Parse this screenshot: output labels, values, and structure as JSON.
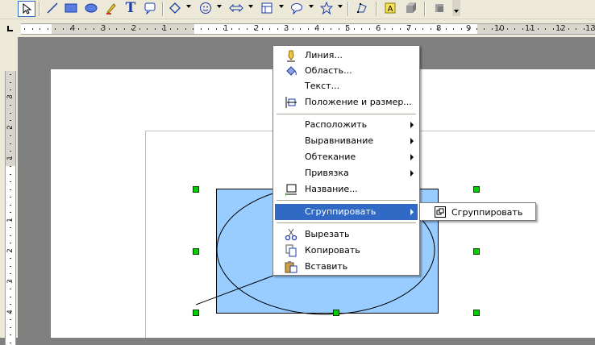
{
  "toolbar": {
    "buttons": [
      {
        "id": "select",
        "icon": "select-arrow-icon"
      },
      {
        "id": "line",
        "icon": "line-icon"
      },
      {
        "id": "rectangle",
        "icon": "rectangle-icon"
      },
      {
        "id": "ellipse",
        "icon": "ellipse-icon"
      },
      {
        "id": "freeform",
        "icon": "pencil-icon"
      },
      {
        "id": "text",
        "icon": "text-icon",
        "glyph": "T"
      },
      {
        "id": "callouts",
        "icon": "callout-icon"
      },
      {
        "id": "basic-shapes",
        "icon": "diamond-icon"
      },
      {
        "id": "symbol-shapes",
        "icon": "smiley-icon"
      },
      {
        "id": "block-arrows",
        "icon": "double-arrow-icon"
      },
      {
        "id": "flowchart",
        "icon": "flowchart-icon"
      },
      {
        "id": "callout-shapes",
        "icon": "speech-bubble-icon"
      },
      {
        "id": "stars",
        "icon": "star-icon"
      },
      {
        "id": "points",
        "icon": "points-icon"
      },
      {
        "id": "fontwork",
        "icon": "fontwork-icon"
      },
      {
        "id": "extrusion",
        "icon": "extrusion-icon"
      },
      {
        "id": "more",
        "icon": "chevron-down-icon"
      }
    ]
  },
  "rulers": {
    "horizontal_labels": [
      "4",
      "3",
      "2",
      "1",
      "1",
      "2",
      "3",
      "4",
      "5",
      "6",
      "7",
      "8",
      "9",
      "10",
      "11",
      "12",
      "13"
    ],
    "vertical_labels": [
      "3",
      "2",
      "1",
      "1",
      "2",
      "3",
      "4"
    ]
  },
  "context_menu": {
    "items": [
      {
        "label": "Линия...",
        "icon": "line-pen-icon",
        "submenu": false
      },
      {
        "label": "Область...",
        "icon": "paint-bucket-icon",
        "submenu": false
      },
      {
        "label": "Текст...",
        "icon": "",
        "submenu": false
      },
      {
        "label": "Положение и размер...",
        "icon": "position-size-icon",
        "submenu": false
      },
      {
        "label": "Расположить",
        "icon": "",
        "submenu": true
      },
      {
        "label": "Выравнивание",
        "icon": "",
        "submenu": true
      },
      {
        "label": "Обтекание",
        "icon": "",
        "submenu": true
      },
      {
        "label": "Привязка",
        "icon": "",
        "submenu": true
      },
      {
        "label": "Название...",
        "icon": "caption-icon",
        "submenu": false
      },
      {
        "label": "Сгруппировать",
        "icon": "",
        "submenu": true,
        "highlighted": true
      },
      {
        "label": "Вырезать",
        "icon": "scissors-icon",
        "submenu": false
      },
      {
        "label": "Копировать",
        "icon": "copy-icon",
        "submenu": false
      },
      {
        "label": "Вставить",
        "icon": "paste-icon",
        "submenu": false
      }
    ]
  },
  "submenu": {
    "items": [
      {
        "label": "Сгруппировать",
        "icon": "group-icon"
      }
    ]
  },
  "colors": {
    "highlight": "#316AC5",
    "shape_fill": "#99CCFF",
    "handle": "#00CC00"
  }
}
